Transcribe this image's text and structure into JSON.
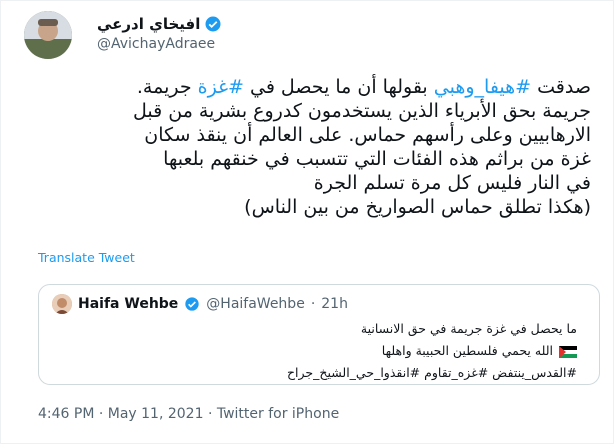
{
  "author": {
    "display_name": "افيخاي ادرعي",
    "handle": "@AvichayAdraee"
  },
  "tweet": {
    "lines": [
      [
        {
          "t": "صدقت ",
          "tag": false
        },
        {
          "t": "#هيفا_وهبي",
          "tag": true
        },
        {
          "t": " بقولها أن ما يحصل في ",
          "tag": false
        },
        {
          "t": "#غزة",
          "tag": true
        },
        {
          "t": " جريمة.",
          "tag": false
        }
      ],
      [
        {
          "t": "جريمة بحق الأبرياء الذين يستخدمون كدروع بشرية من قبل",
          "tag": false
        }
      ],
      [
        {
          "t": "الارهابيين وعلى رأسهم حماس. على العالم أن ينقذ سكان",
          "tag": false
        }
      ],
      [
        {
          "t": "غزة من براثم هذه الفئات التي تتسبب في خنقهم بلعبها",
          "tag": false
        }
      ],
      [
        {
          "t": "في النار فليس كل مرة تسلم الجرة",
          "tag": false
        }
      ],
      [
        {
          "t": "(هكذا تطلق حماس الصواريخ من بين الناس)",
          "tag": false
        }
      ]
    ]
  },
  "translate_label": "Translate Tweet",
  "quote": {
    "name": "Haifa Wehbe",
    "handle": "@HaifaWehbe",
    "dot": "·",
    "time": "21h",
    "line1": "ما يحصل في غزة جريمة في حق الانسانية",
    "line2": "الله يحمي فلسطين الحبيبة واهلها",
    "line3": "#القدس_ينتفض #غزه_تقاوم #انقذوا_حي_الشيخ_جراح"
  },
  "meta": "4:46 PM · May 11, 2021 · Twitter for iPhone",
  "colors": {
    "accent": "#1d9bf0",
    "text": "#0f1419",
    "muted": "#536471"
  },
  "icons": [
    "verified-badge-icon",
    "palestine-flag-icon"
  ]
}
